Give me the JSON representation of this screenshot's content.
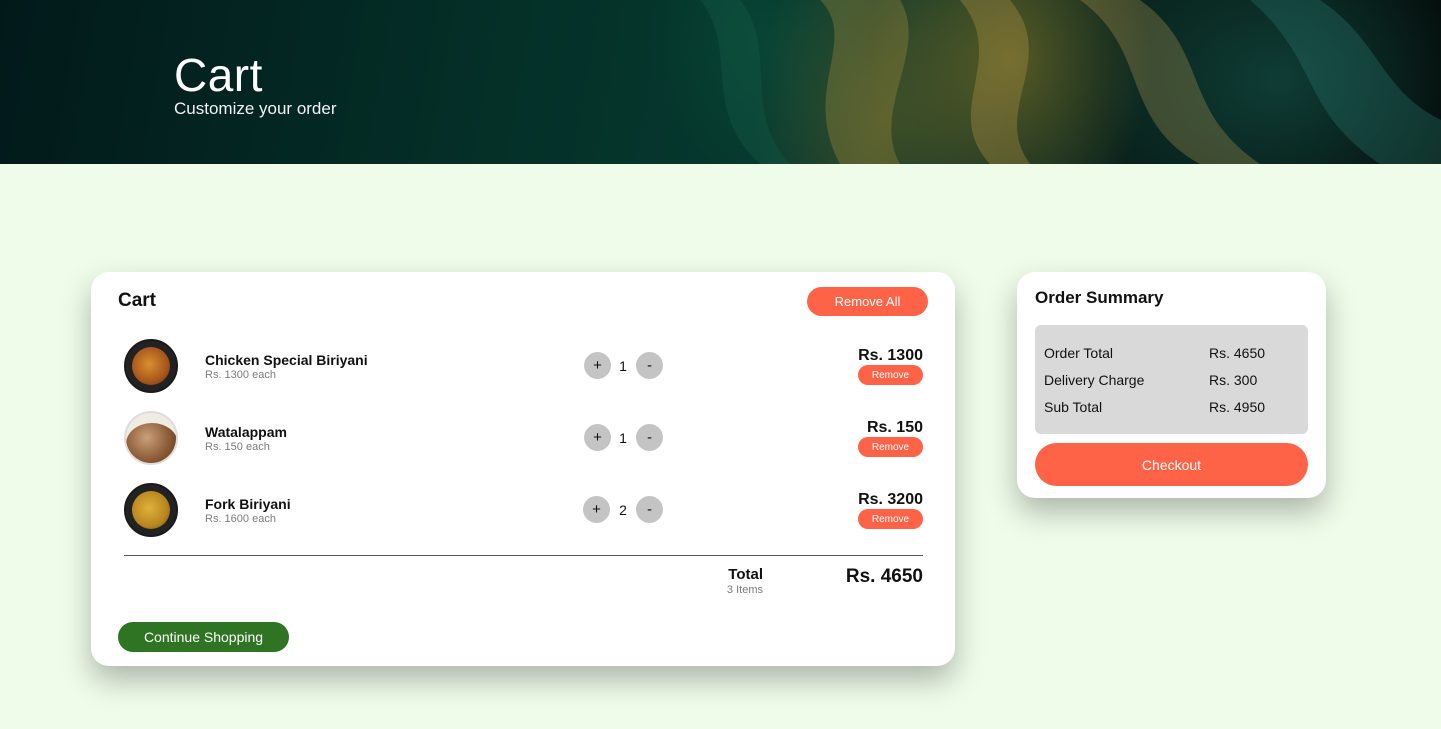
{
  "hero": {
    "title": "Cart",
    "subtitle": "Customize your order"
  },
  "cart": {
    "title": "Cart",
    "remove_all_label": "Remove All",
    "items": [
      {
        "name": "Chicken Special Biriyani",
        "each": "Rs. 1300 each",
        "qty": "1",
        "price": "Rs. 1300",
        "remove_label": "Remove",
        "plus": "+",
        "minus": "-",
        "image": "chicken-biriyani"
      },
      {
        "name": "Watalappam",
        "each": "Rs. 150 each",
        "qty": "1",
        "price": "Rs. 150",
        "remove_label": "Remove",
        "plus": "+",
        "minus": "-",
        "image": "watalappam"
      },
      {
        "name": "Fork Biriyani",
        "each": "Rs. 1600 each",
        "qty": "2",
        "price": "Rs. 3200",
        "remove_label": "Remove",
        "plus": "+",
        "minus": "-",
        "image": "fork-biriyani"
      }
    ],
    "total_label": "Total",
    "total_items": "3 Items",
    "total_amount": "Rs. 4650",
    "continue_label": "Continue Shopping"
  },
  "summary": {
    "title": "Order Summary",
    "rows": [
      {
        "label": "Order Total",
        "value": "Rs. 4650"
      },
      {
        "label": "Delivery Charge",
        "value": "Rs. 300"
      },
      {
        "label": "Sub Total",
        "value": "Rs. 4950"
      }
    ],
    "checkout_label": "Checkout"
  },
  "colors": {
    "accent": "#ff6347",
    "continue": "#2e7423",
    "page_bg": "#effcea",
    "summary_box": "#d9d9d9"
  }
}
